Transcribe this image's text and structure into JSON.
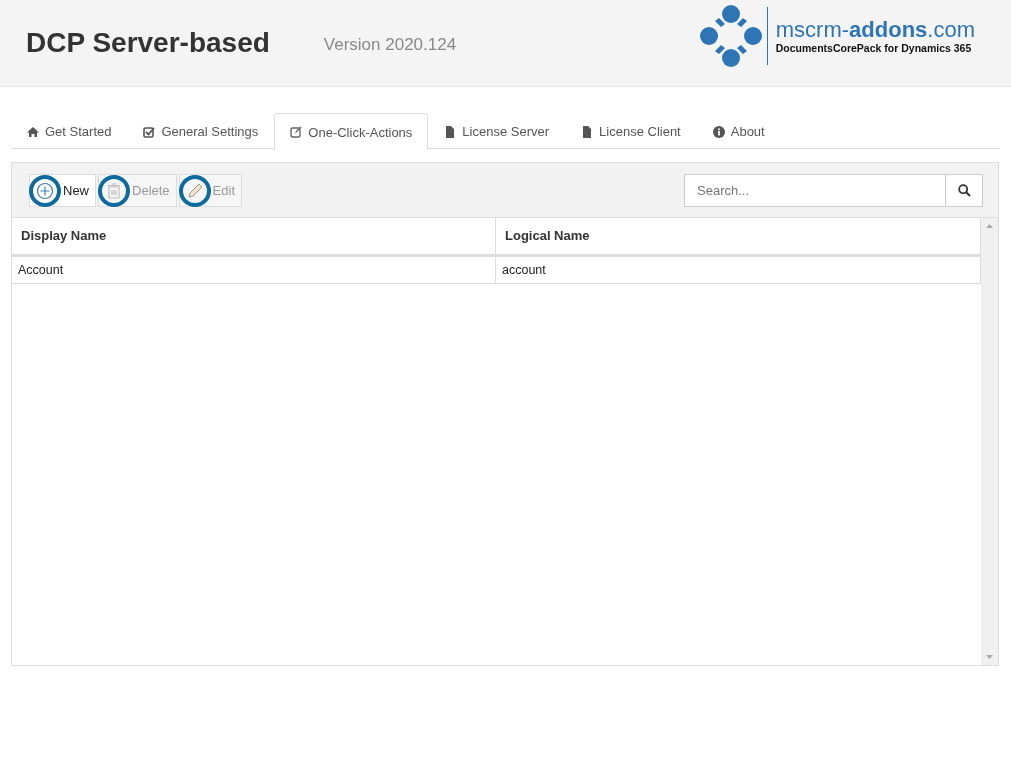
{
  "header": {
    "title": "DCP Server-based",
    "version": "Version 2020.124",
    "logo": {
      "name": "mscrm-",
      "name_bold": "addons",
      ".tld": ".com",
      "tagline": "DocumentsCorePack for Dynamics 365"
    }
  },
  "tabs": [
    {
      "label": "Get Started",
      "kind": "home",
      "selected": false
    },
    {
      "label": "General Settings",
      "kind": "check",
      "selected": false
    },
    {
      "label": "One-Click-Actions",
      "kind": "edit",
      "selected": true
    },
    {
      "label": "License Server",
      "kind": "file",
      "selected": false
    },
    {
      "label": "License Client",
      "kind": "file",
      "selected": false
    },
    {
      "label": "About",
      "kind": "info",
      "selected": false
    }
  ],
  "toolbar": {
    "buttons": [
      {
        "label": "New",
        "kind": "plus",
        "disabled": false,
        "highlighted": true
      },
      {
        "label": "Delete",
        "kind": "trash",
        "disabled": true,
        "highlighted": true
      },
      {
        "label": "Edit",
        "kind": "pencil",
        "disabled": true,
        "highlighted": true
      }
    ],
    "search": {
      "placeholder": "Search..."
    }
  },
  "table": {
    "columns": [
      "Display Name",
      "Logical Name"
    ],
    "rows": [
      [
        "Account",
        "account"
      ]
    ]
  }
}
